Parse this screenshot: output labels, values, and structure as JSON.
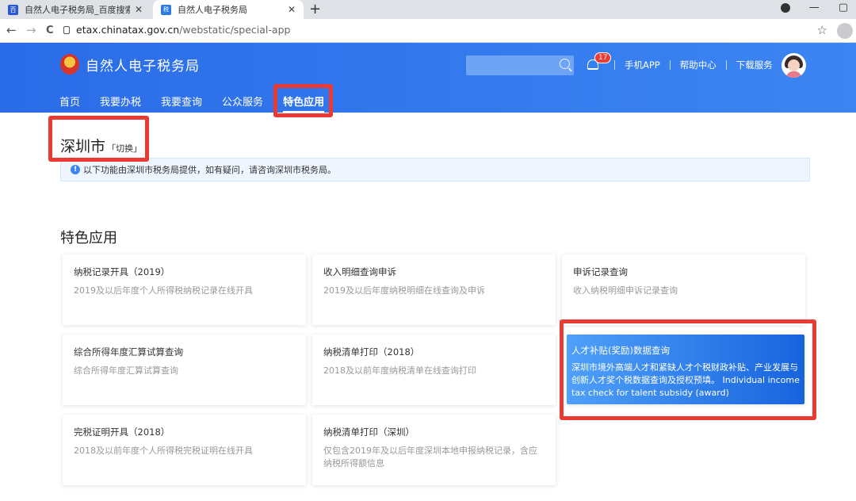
{
  "browser": {
    "tabs": [
      {
        "title": "自然人电子税务局_百度搜索",
        "favicon": "baidu-paw"
      },
      {
        "title": "自然人电子税务局",
        "favicon": "tax-bureau"
      }
    ],
    "new_tab": "+",
    "url_host": "etax.chinatax.gov.cn",
    "url_path": "/webstatic/special-app",
    "nav": {
      "back": "←",
      "forward": "→",
      "reload": "C"
    },
    "star": "☆"
  },
  "header": {
    "logo_text": "自然人电子税务局",
    "search_placeholder": "",
    "notification_count": "17",
    "links": [
      "手机APP",
      "帮助中心",
      "下载服务"
    ],
    "nav": [
      "首页",
      "我要办税",
      "我要查询",
      "公众服务",
      "特色应用"
    ],
    "active_nav": "特色应用"
  },
  "city": {
    "name": "深圳市",
    "switch_label": "「切换」"
  },
  "notice": {
    "icon": "!",
    "text": "以下功能由深圳市税务局提供，如有疑问，请咨询深圳市税务局。"
  },
  "section_title": "特色应用",
  "cards": [
    {
      "title": "纳税记录开具（2019）",
      "desc": "2019及以后年度个人所得税纳税记录在线开具"
    },
    {
      "title": "收入明细查询申诉",
      "desc": "2019及以后年度纳税明细在线查询及申诉"
    },
    {
      "title": "申诉记录查询",
      "desc": "收入纳税明细申诉记录查询"
    },
    {
      "title": "综合所得年度汇算试算查询",
      "desc": "综合所得年度汇算试算查询"
    },
    {
      "title": "纳税清单打印（2018）",
      "desc": "2018及以前年度纳税清单在线查询打印"
    },
    {
      "title": "人才补贴(奖励)数据查询",
      "desc": "深圳市境外高端人才和紧缺人才个税财政补贴、产业发展与创新人才奖个税数据查询及授权预填。 Individual income tax check for talent subsidy (award)"
    },
    {
      "title": "完税证明开具（2018）",
      "desc": "2018及以前年度个人所得税完税证明在线开具"
    },
    {
      "title": "纳税清单打印（深圳）",
      "desc": "仅包含2019年及以后年度深圳本地申报纳税记录，含应纳税所得额信息"
    }
  ],
  "colors": {
    "header_blue": "#2a6ce8",
    "highlight_start": "#4fa0fa",
    "highlight_end": "#1763de",
    "annotation_red": "#e93b33"
  }
}
